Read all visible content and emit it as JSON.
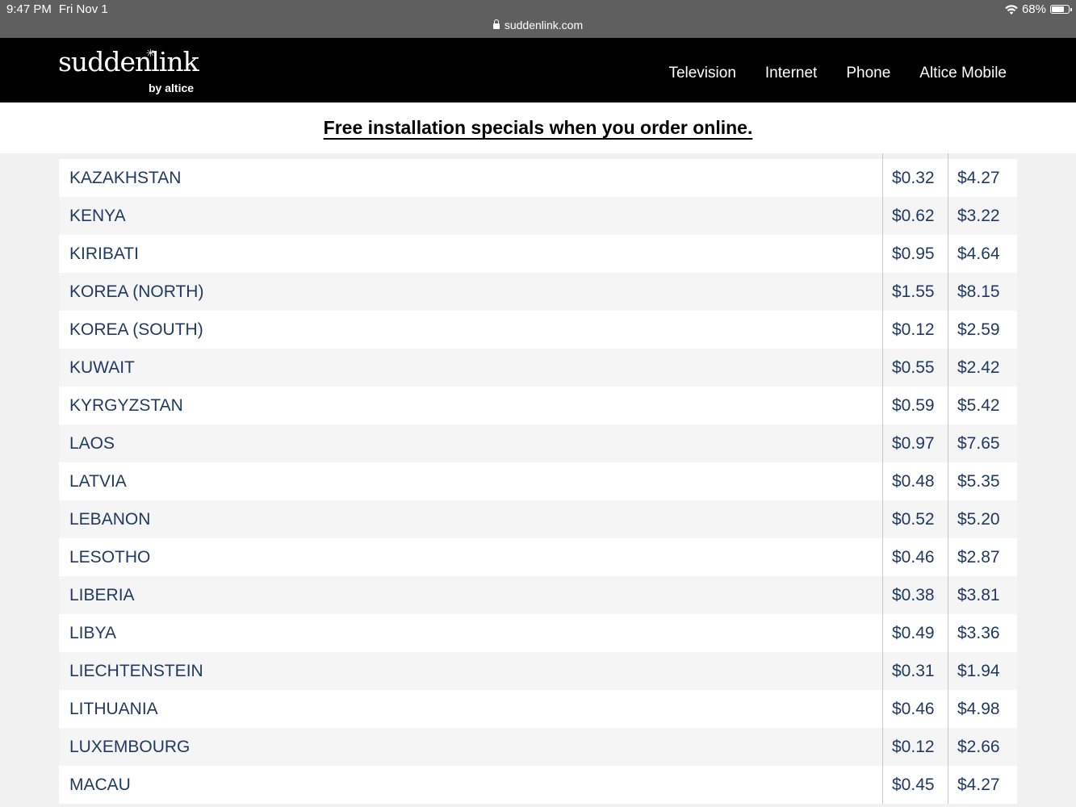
{
  "status": {
    "time": "9:47 PM",
    "date": "Fri Nov 1",
    "battery": "68%",
    "battery_level": 0.68,
    "url": "suddenlink.com"
  },
  "brand": {
    "wordmark": "suddenlink",
    "tagline": "by altice"
  },
  "nav": {
    "items": [
      "Television",
      "Internet",
      "Phone",
      "Altice Mobile"
    ]
  },
  "promo": {
    "text": "Free installation specials when you order online."
  },
  "rates": {
    "rows": [
      {
        "country": "KAZAKHSTAN",
        "rate1": "$0.32",
        "rate2": "$4.27"
      },
      {
        "country": "KENYA",
        "rate1": "$0.62",
        "rate2": "$3.22"
      },
      {
        "country": "KIRIBATI",
        "rate1": "$0.95",
        "rate2": "$4.64"
      },
      {
        "country": "KOREA (NORTH)",
        "rate1": "$1.55",
        "rate2": "$8.15"
      },
      {
        "country": "KOREA (SOUTH)",
        "rate1": "$0.12",
        "rate2": "$2.59"
      },
      {
        "country": "KUWAIT",
        "rate1": "$0.55",
        "rate2": "$2.42"
      },
      {
        "country": "KYRGYZSTAN",
        "rate1": "$0.59",
        "rate2": "$5.42"
      },
      {
        "country": "LAOS",
        "rate1": "$0.97",
        "rate2": "$7.65"
      },
      {
        "country": "LATVIA",
        "rate1": "$0.48",
        "rate2": "$5.35"
      },
      {
        "country": "LEBANON",
        "rate1": "$0.52",
        "rate2": "$5.20"
      },
      {
        "country": "LESOTHO",
        "rate1": "$0.46",
        "rate2": "$2.87"
      },
      {
        "country": "LIBERIA",
        "rate1": "$0.38",
        "rate2": "$3.81"
      },
      {
        "country": "LIBYA",
        "rate1": "$0.49",
        "rate2": "$3.36"
      },
      {
        "country": "LIECHTENSTEIN",
        "rate1": "$0.31",
        "rate2": "$1.94"
      },
      {
        "country": "LITHUANIA",
        "rate1": "$0.46",
        "rate2": "$4.98"
      },
      {
        "country": "LUXEMBOURG",
        "rate1": "$0.12",
        "rate2": "$2.66"
      },
      {
        "country": "MACAU",
        "rate1": "$0.45",
        "rate2": "$4.27"
      }
    ]
  }
}
